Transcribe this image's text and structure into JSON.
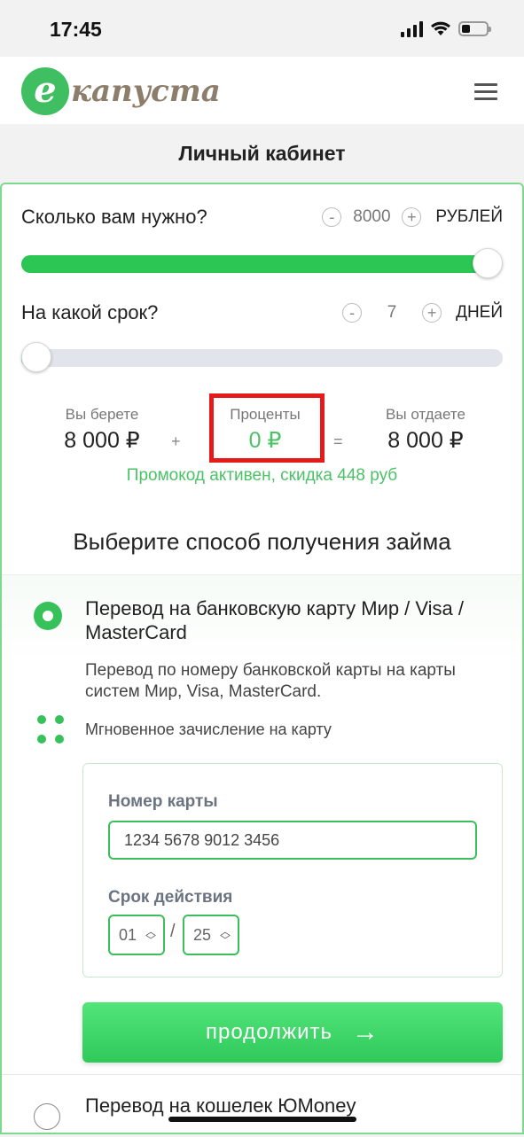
{
  "status_bar": {
    "time": "17:45"
  },
  "header": {
    "logo_mark": "е",
    "logo_text": "капуста"
  },
  "page": {
    "title": "Личный кабинет"
  },
  "amount": {
    "question": "Сколько вам нужно?",
    "minus": "-",
    "plus": "+",
    "value": "8000",
    "unit": "РУБЛЕЙ",
    "slider_fraction": 1.0
  },
  "term": {
    "question": "На какой срок?",
    "minus": "-",
    "plus": "+",
    "value": "7",
    "unit": "ДНЕЙ",
    "slider_fraction": 0.0
  },
  "summary": {
    "take_label": "Вы берете",
    "take_value": "8 000 ₽",
    "plus": "+",
    "interest_label": "Проценты",
    "interest_value": "0 ₽",
    "equals": "=",
    "return_label": "Вы отдаете",
    "return_value": "8 000 ₽",
    "promo": "Промокод активен, скидка 448 руб"
  },
  "method": {
    "section_title": "Выберите способ получения займа",
    "card_option": {
      "title": "Перевод на банковскую карту Мир / Visa / MasterCard",
      "description": "Перевод по номеру банковской карты на карты систем Мир, Visa, MasterCard.",
      "instant": "Мгновенное зачисление на карту",
      "card_number_label": "Номер карты",
      "card_number_value": "1234 5678 9012 3456",
      "expiry_label": "Срок действия",
      "expiry_month": "01",
      "expiry_separator": "/",
      "expiry_year": "25",
      "continue_label": "продолжить",
      "continue_arrow": "→"
    },
    "yumoney_option": {
      "title": "Перевод на кошелек ЮMoney"
    }
  },
  "colors": {
    "accent": "#2cc654",
    "highlight": "#e51a1a",
    "promo": "#4cc267"
  }
}
